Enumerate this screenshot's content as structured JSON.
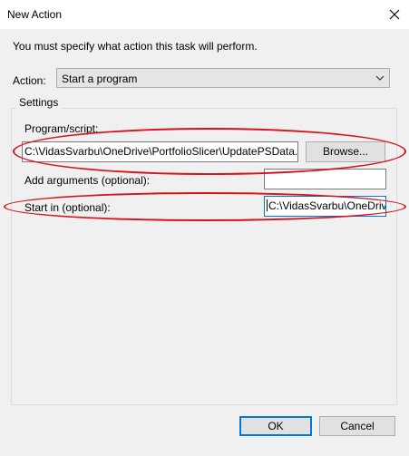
{
  "window": {
    "title": "New Action"
  },
  "instruction": "You must specify what action this task will perform.",
  "action": {
    "label": "Action:",
    "selected": "Start a program"
  },
  "settings": {
    "title": "Settings",
    "program_label": "Program/script:",
    "program_value": "C:\\VidasSvarbu\\OneDrive\\PortfolioSlicer\\UpdatePSData.b",
    "browse_label": "Browse...",
    "arguments_label": "Add arguments (optional):",
    "arguments_value": "",
    "startin_label": "Start in (optional):",
    "startin_value": "C:\\VidasSvarbu\\OneDriv"
  },
  "buttons": {
    "ok": "OK",
    "cancel": "Cancel"
  },
  "colors": {
    "annotation": "#d8121b",
    "focus": "#0078d7"
  }
}
